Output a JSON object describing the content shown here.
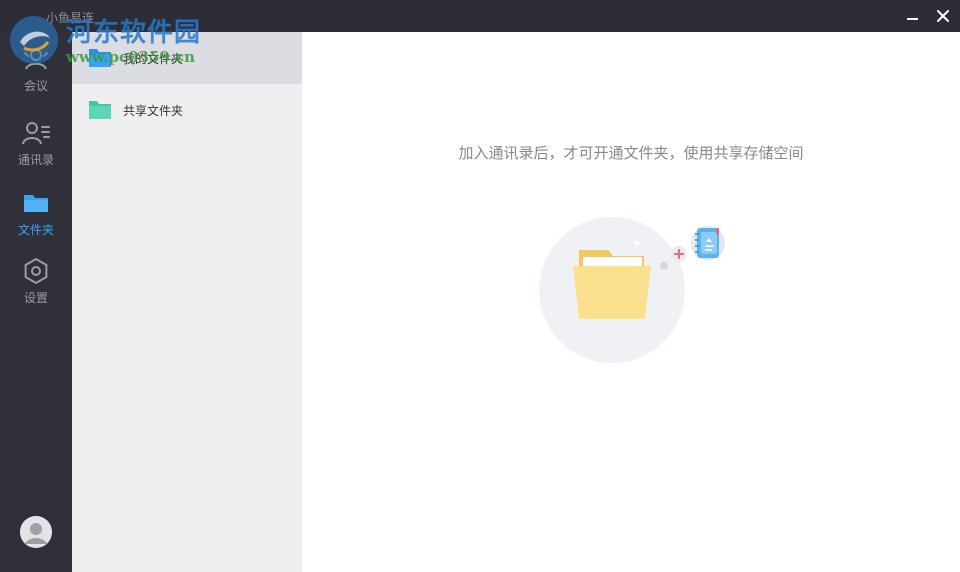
{
  "app": {
    "title": "小鱼易连"
  },
  "window_controls": {
    "minimize_icon": "minimize-icon",
    "close_icon": "close-icon",
    "close_glyph": "✕"
  },
  "nav": {
    "items": [
      {
        "label": "会议",
        "icon": "meeting-icon",
        "active": false
      },
      {
        "label": "通讯录",
        "icon": "contacts-icon",
        "active": false
      },
      {
        "label": "文件夹",
        "icon": "folder-icon",
        "active": true
      },
      {
        "label": "设置",
        "icon": "gear-icon",
        "active": false
      }
    ],
    "avatar_icon": "user-avatar-icon"
  },
  "folders": [
    {
      "label": "我的文件夹",
      "selected": true,
      "color": "#3aa2f2"
    },
    {
      "label": "共享文件夹",
      "selected": false,
      "color": "#5dd6b6"
    }
  ],
  "main": {
    "hint": "加入通讯录后，才可开通文件夹，使用共享存储空间",
    "illustration_icon": "folder-with-contacts-illustration"
  },
  "watermark": {
    "site_name": "河东软件园",
    "url": "www.pc0359.cn"
  },
  "colors": {
    "accent": "#3aa2f2",
    "sidebar": "#2f3039",
    "titlebar": "#2c2d36",
    "panel": "#efeff2",
    "selected_row": "#dcdde3"
  }
}
